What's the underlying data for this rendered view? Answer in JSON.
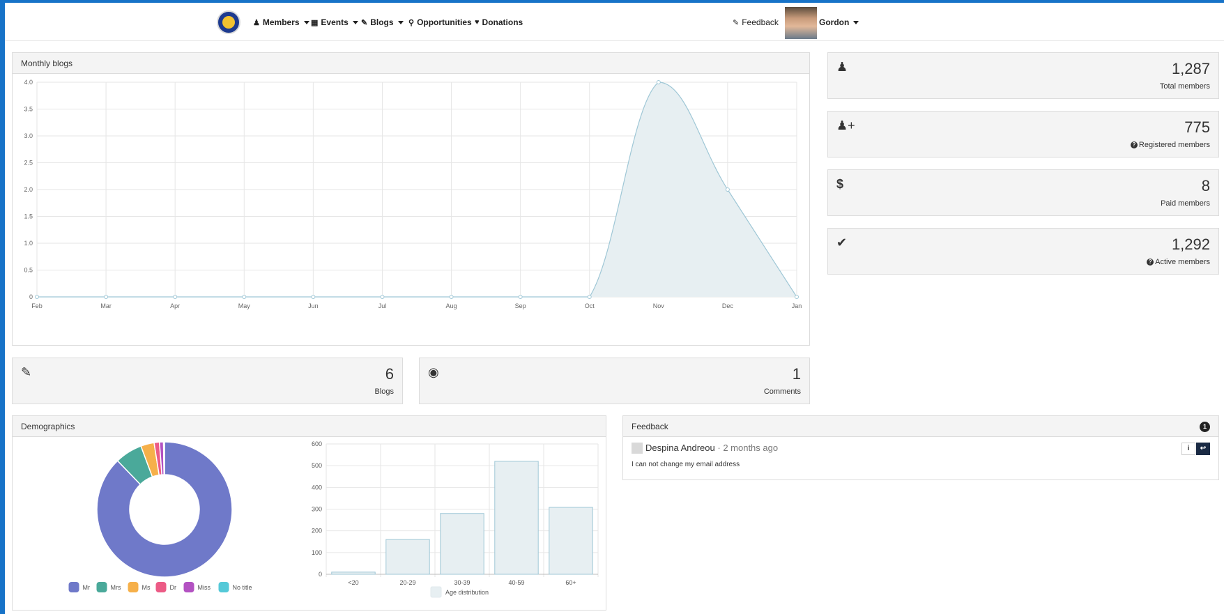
{
  "nav": {
    "items": [
      {
        "label": "Members",
        "icon": "user-icon",
        "dropdown": true
      },
      {
        "label": "Events",
        "icon": "calendar-icon",
        "dropdown": true
      },
      {
        "label": "Blogs",
        "icon": "pencil-icon",
        "dropdown": true
      },
      {
        "label": "Opportunities",
        "icon": "lightbulb-icon",
        "dropdown": false
      },
      {
        "label": "Donations",
        "icon": "heart-icon",
        "dropdown": false
      }
    ],
    "feedback_label": "Feedback",
    "user_name": "Gordon"
  },
  "monthly_blogs": {
    "title": "Monthly blogs"
  },
  "stats": {
    "total_members": {
      "value": "1,287",
      "label": "Total members",
      "icon": "user-icon"
    },
    "registered_members": {
      "value": "775",
      "label": "Registered members",
      "icon": "user-plus-icon"
    },
    "paid_members": {
      "value": "8",
      "label": "Paid members",
      "icon": "dollar-icon"
    },
    "active_members": {
      "value": "1,292",
      "label": "Active members",
      "icon": "check-circle-icon"
    },
    "blogs": {
      "value": "6",
      "label": "Blogs",
      "icon": "pencil-icon"
    },
    "comments": {
      "value": "1",
      "label": "Comments",
      "icon": "comment-icon"
    }
  },
  "demographics": {
    "title": "Demographics"
  },
  "feedback": {
    "title": "Feedback",
    "count": "1",
    "entries": [
      {
        "author": "Despina Andreou",
        "time": "· 2 months ago",
        "message": "I can not change my email address"
      }
    ]
  },
  "colors": {
    "accent_blue": "#1773c8",
    "area_fill": "#e7eff2",
    "area_stroke": "#9fc7d6"
  },
  "chart_data": [
    {
      "type": "area",
      "title": "Monthly blogs",
      "categories": [
        "Feb",
        "Mar",
        "Apr",
        "May",
        "Jun",
        "Jul",
        "Aug",
        "Sep",
        "Oct",
        "Nov",
        "Dec",
        "Jan"
      ],
      "values": [
        0,
        0,
        0,
        0,
        0,
        0,
        0,
        0,
        0,
        4,
        2,
        0
      ],
      "yticks": [
        "0",
        "0.5",
        "1.0",
        "1.5",
        "2.0",
        "2.5",
        "3.0",
        "3.5",
        "4.0"
      ],
      "ylim": [
        0,
        4
      ],
      "grid": true
    },
    {
      "type": "pie",
      "donut": true,
      "categories": [
        "Mr",
        "Mrs",
        "Ms",
        "Dr",
        "Miss",
        "No title"
      ],
      "values": [
        1100,
        82,
        40,
        16,
        12,
        3
      ],
      "colors": [
        "#6f79c9",
        "#4aa99a",
        "#f6b04a",
        "#ec5b86",
        "#b352c2",
        "#55c9d8"
      ],
      "legend": "bottom"
    },
    {
      "type": "bar",
      "categories": [
        "<20",
        "20-29",
        "30-39",
        "40-59",
        "60+"
      ],
      "values": [
        10,
        160,
        280,
        520,
        308
      ],
      "yticks": [
        "0",
        "100",
        "200",
        "300",
        "400",
        "500",
        "600"
      ],
      "ylim": [
        0,
        600
      ],
      "series_name": "Age distribution",
      "legend": "bottom",
      "grid": true
    }
  ]
}
